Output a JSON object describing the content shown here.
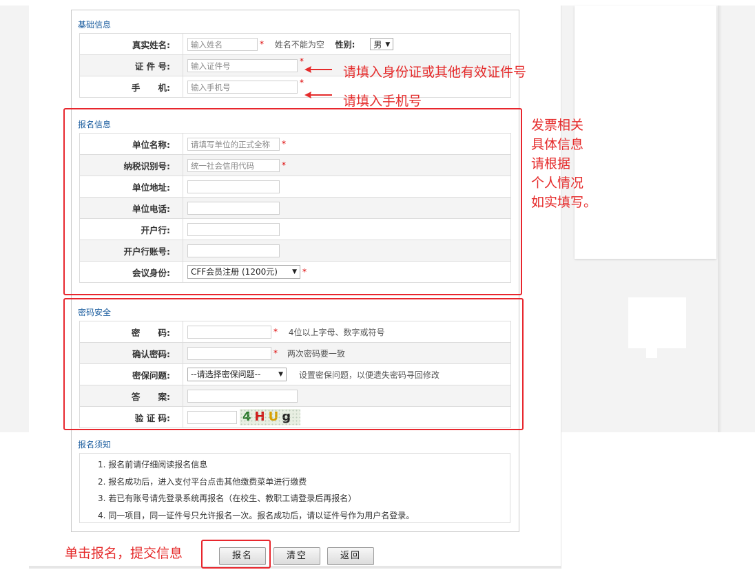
{
  "basic": {
    "title": "基础信息",
    "name_label": "真实姓名:",
    "name_placeholder": "输入姓名",
    "name_hint": "姓名不能为空",
    "gender_label": "性别:",
    "gender_value": "男",
    "id_label": "证 件 号:",
    "id_placeholder": "输入证件号",
    "phone_label": "手      机:",
    "phone_placeholder": "输入手机号"
  },
  "registration": {
    "title": "报名信息",
    "unit_name_label": "单位名称:",
    "unit_name_placeholder": "请填写单位的正式全称",
    "tax_id_label": "纳税识别号:",
    "tax_id_placeholder": "统一社会信用代码",
    "unit_address_label": "单位地址:",
    "unit_phone_label": "单位电话:",
    "bank_label": "开户行:",
    "bank_account_label": "开户行账号:",
    "role_label": "会议身份:",
    "role_value": "CFF会员注册 (1200元)"
  },
  "security": {
    "title": "密码安全",
    "password_label": "密      码:",
    "password_hint": "4位以上字母、数字或符号",
    "confirm_label": "确认密码:",
    "confirm_hint": "两次密码要一致",
    "question_label": "密保问题:",
    "question_value": "--请选择密保问题--",
    "question_hint": "设置密保问题，以便遗失密码寻回修改",
    "answer_label": "答      案:",
    "captcha_label": "验 证 码:",
    "captcha_text": [
      "4",
      "H",
      "U",
      "g"
    ]
  },
  "notice": {
    "title": "报名须知",
    "items": [
      "1.  报名前请仔细阅读报名信息",
      "2.  报名成功后，进入支付平台点击其他缴费菜单进行缴费",
      "3.  若已有账号请先登录系统再报名（在校生、教职工请登录后再报名）",
      "4.  同一项目，同一证件号只允许报名一次。报名成功后，请以证件号作为用户名登录。"
    ]
  },
  "buttons": {
    "submit": "报名",
    "clear": "清空",
    "back": "返回"
  },
  "annotations": {
    "id_note": "请填入身份证或其他有效证件号",
    "phone_note": "请填入手机号",
    "invoice_note": [
      "发票相关",
      "具体信息",
      "请根据",
      "个人情况",
      "如实填写。"
    ],
    "submit_note": "单击报名，提交信息"
  },
  "colors": {
    "annotation_red": "#e52b2b",
    "section_title_blue": "#1a5c9e",
    "required_star": "#dd0000"
  }
}
